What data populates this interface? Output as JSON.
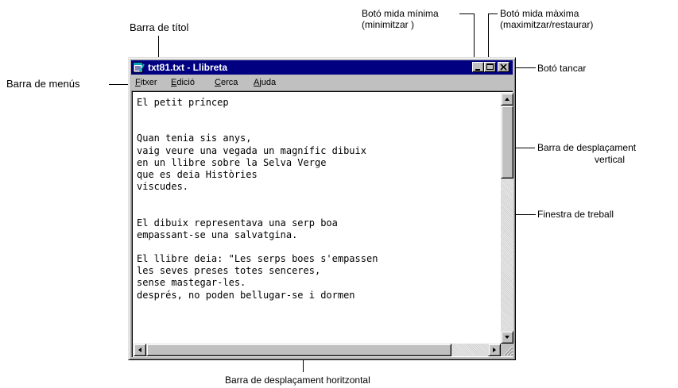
{
  "window": {
    "title": "txt81.txt - Llibreta",
    "menu": [
      {
        "label": "Fitxer",
        "u": "F",
        "rest": "itxer"
      },
      {
        "label": "Edició",
        "u": "E",
        "rest": "dició"
      },
      {
        "label": "Cerca",
        "u": "C",
        "rest": "erca"
      },
      {
        "label": "Ajuda",
        "u": "A",
        "rest": "juda"
      }
    ],
    "content_lines": [
      "El petit príncep",
      "",
      "",
      "Quan tenia sis anys,",
      "vaig veure una vegada un magnífic dibuix",
      "en un llibre sobre la Selva Verge",
      "que es deia Històries",
      "viscudes.",
      "",
      "",
      "El dibuix representava una serp boa",
      "empassant-se una salvatgina.",
      "",
      "El llibre deia: \"Les serps boes s'empassen",
      "les seves preses totes senceres,",
      "sense mastegar-les.",
      "després, no poden bellugar-se i dormen"
    ],
    "vertical_scroll_position": 0,
    "horizontal_scroll_position": 0
  },
  "annotations": {
    "title_bar": "Barra de títol",
    "menu_bar": "Barra de menús",
    "minimize_line1": "Botó mida mínima",
    "minimize_line2": "(minimitzar )",
    "maximize_line1": "Botó mida màxima",
    "maximize_line2": "(maximitzar/restaurar)",
    "close": "Botó tancar",
    "vscroll_line1": "Barra de desplaçament",
    "vscroll_line2": "vertical",
    "work_area": "Finestra de treball",
    "hscroll": "Barra de desplaçament horitzontal"
  },
  "colors": {
    "titlebar": "#000080",
    "window_face": "#c0c0c0",
    "client_background": "#ffffff"
  },
  "icons": [
    "notepad-app-icon",
    "minimize-icon",
    "maximize-icon",
    "close-icon",
    "arrow-up-icon",
    "arrow-down-icon",
    "arrow-left-icon",
    "arrow-right-icon",
    "size-grip-icon"
  ]
}
